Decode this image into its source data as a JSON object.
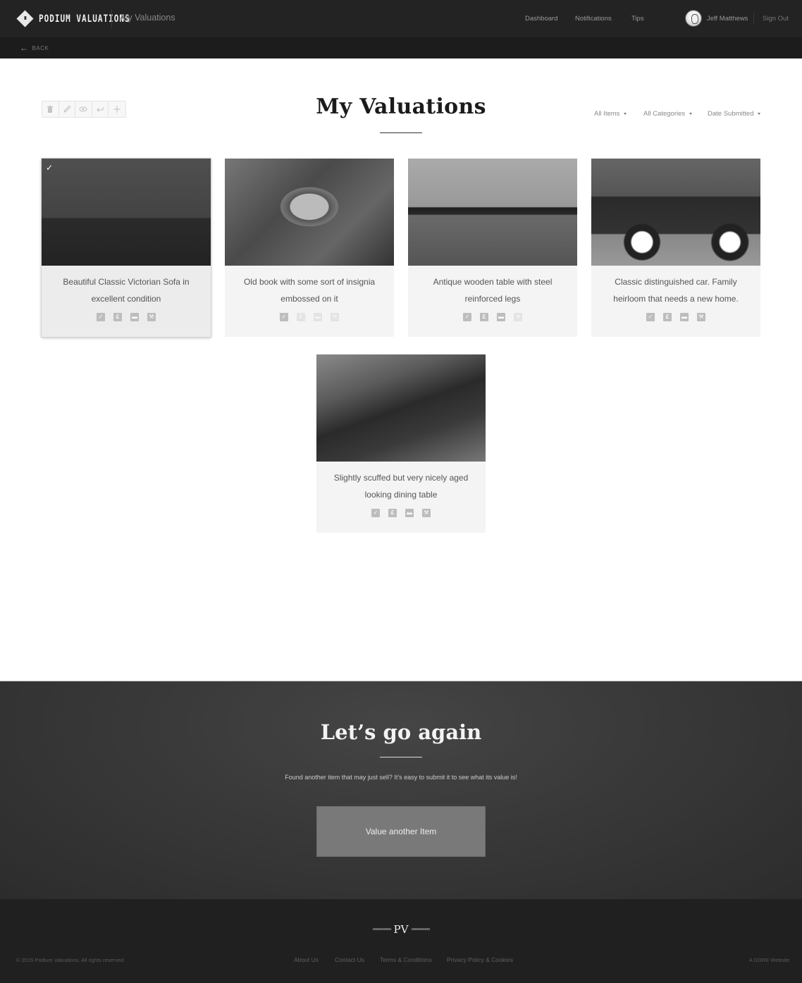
{
  "header": {
    "brand": "PODIUM VALUATIONS",
    "brand_mark": "III",
    "page_title": "My Valuations",
    "nav": [
      "Dashboard",
      "Notifications",
      "Tips"
    ],
    "user_name": "Jeff Matthews",
    "sign_out": "Sign Out"
  },
  "subbar": {
    "back_label": "BACK",
    "back_icon": "arrow-left-icon"
  },
  "toolbar": {
    "tools": [
      {
        "name": "delete",
        "icon": "trash-icon"
      },
      {
        "name": "edit",
        "icon": "pencil-icon"
      },
      {
        "name": "view",
        "icon": "eye-icon"
      },
      {
        "name": "return",
        "icon": "return-arrow-icon"
      },
      {
        "name": "add",
        "icon": "plus-icon"
      }
    ]
  },
  "main": {
    "title": "My Valuations",
    "filters": [
      "All Items",
      "All Categories",
      "Date Submitted"
    ]
  },
  "items": [
    {
      "caption": "Beautiful Classic Victorian Sofa in excellent condition",
      "image": "victorian-sofa-photo",
      "selected": true,
      "status": {
        "approved": true,
        "priced": true,
        "messages": true,
        "auction": true
      }
    },
    {
      "caption": "Old book with some sort of insignia embossed on it",
      "image": "old-book-photo",
      "selected": false,
      "status": {
        "approved": true,
        "priced": false,
        "messages": false,
        "auction": false
      }
    },
    {
      "caption": "Antique wooden table with steel reinforced legs",
      "image": "wooden-table-photo",
      "selected": false,
      "status": {
        "approved": true,
        "priced": true,
        "messages": true,
        "auction": false
      }
    },
    {
      "caption": "Classic distinguished car. Family heirloom that needs a new home.",
      "image": "classic-car-photo",
      "selected": false,
      "status": {
        "approved": true,
        "priced": true,
        "messages": true,
        "auction": true
      }
    },
    {
      "caption": "Slightly scuffed but very nicely aged looking dining table",
      "image": "dining-table-photo",
      "selected": false,
      "status": {
        "approved": true,
        "priced": true,
        "messages": true,
        "auction": true
      }
    }
  ],
  "status_icons": {
    "approved": "✓",
    "priced": "£",
    "messages": "▬",
    "auction": "⚒"
  },
  "cta": {
    "title": "Let’s go again",
    "text": "Found another item that may just sell? It’s easy to submit it to see what its value is!",
    "button": "Value another Item"
  },
  "footer": {
    "logo": "PV",
    "chevrons_left": "»»»»»»»»»",
    "chevrons_right": "«««««««««",
    "copyright": "© 2015 Podium Valuations. All rights reserved.",
    "links": [
      "About Us",
      "Contact Us",
      "Terms & Conditions",
      "Privacy Policy & Cookies"
    ],
    "credit": "A DORE Website"
  }
}
